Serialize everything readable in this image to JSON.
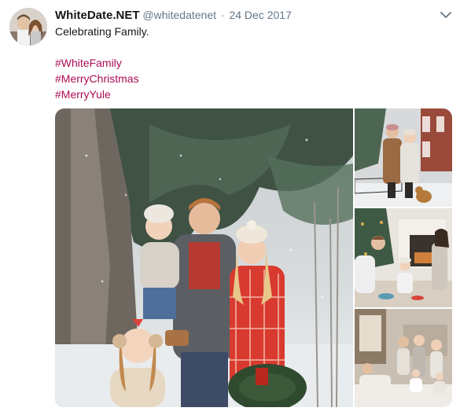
{
  "tweet": {
    "display_name": "WhiteDate.NET",
    "handle": "@whitedatenet",
    "separator": "·",
    "date": "24 Dec 2017",
    "text_lines": [
      "Celebrating Family."
    ],
    "hashtags": [
      "#WhiteFamily",
      "#MerryChristmas",
      "#MerryYule"
    ],
    "avatar_icon": "avatar-photo",
    "menu_icon": "chevron-down-icon",
    "colors": {
      "hashtag": "#ab0c50",
      "meta_text": "#657786",
      "name_text": "#14171a"
    }
  },
  "media": {
    "photos": [
      "family-snow-portrait",
      "couple-with-dog-in-snow",
      "family-by-fireplace",
      "family-living-room"
    ]
  }
}
